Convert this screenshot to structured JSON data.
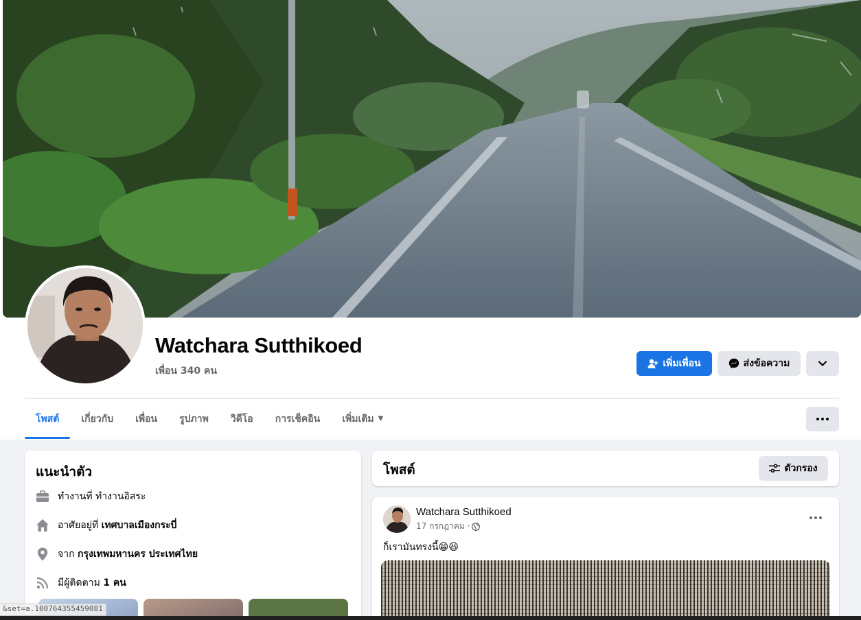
{
  "profile": {
    "name": "Watchara Sutthikoed",
    "friends_count": "เพื่อน 340 คน"
  },
  "actions": {
    "add_friend": "เพิ่มเพื่อน",
    "message": "ส่งข้อความ"
  },
  "tabs": [
    {
      "label": "โพสต์",
      "active": true
    },
    {
      "label": "เกี่ยวกับ",
      "active": false
    },
    {
      "label": "เพื่อน",
      "active": false
    },
    {
      "label": "รูปภาพ",
      "active": false
    },
    {
      "label": "วิดีโอ",
      "active": false
    },
    {
      "label": "การเช็คอิน",
      "active": false
    },
    {
      "label": "เพิ่มเติม",
      "active": false
    }
  ],
  "intro": {
    "title": "แนะนำตัว",
    "work": {
      "prefix": "ทำงานที่",
      "value": "ทำงานอิสระ"
    },
    "lives": {
      "prefix": "อาศัยอยู่ที่",
      "value": "เทศบาลเมืองกระบี่"
    },
    "from": {
      "prefix": "จาก",
      "value": "กรุงเทพมหานคร ประเทศไทย"
    },
    "followers": {
      "prefix": "มีผู้ติดตาม",
      "value": "1 คน"
    }
  },
  "posts_section": {
    "title": "โพสต์",
    "filter_label": "ตัวกรอง"
  },
  "post": {
    "author": "Watchara Sutthikoed",
    "date": "17 กรกฎาคม ·",
    "text": "ก็เรามันทรงนี้😁😆"
  },
  "status_url": "&set=a.100764355459081",
  "colors": {
    "accent": "#1b74e4",
    "secondary_button": "#e4e6eb",
    "page_bg": "#f0f2f5",
    "muted_text": "#65676b"
  }
}
